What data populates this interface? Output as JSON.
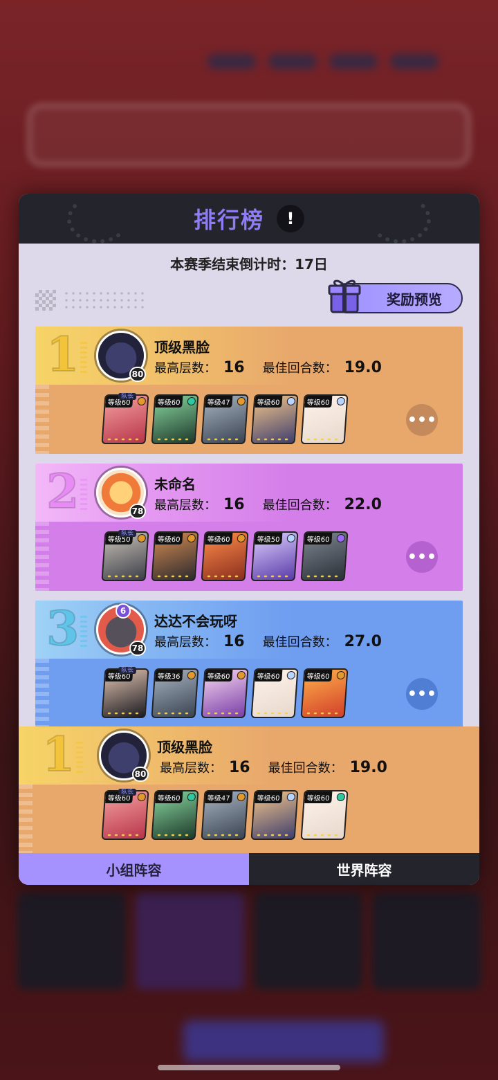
{
  "modal": {
    "title": "排行榜",
    "info_label": "!",
    "countdown": "本赛季结束倒计时：17日",
    "reward_button": "奖励预览"
  },
  "labels": {
    "max_floor": "最高层数：",
    "best_rounds": "最佳回合数："
  },
  "entries": [
    {
      "rank": "1",
      "name": "顶级黑脸",
      "avatar_level": "80",
      "max_floor": "16",
      "best_rounds": "19.0",
      "captain_label": "队长",
      "heroes": [
        "等级60",
        "等级60",
        "等级47",
        "等级60",
        "等级60"
      ],
      "more": "•••"
    },
    {
      "rank": "2",
      "name": "未命名",
      "avatar_level": "78",
      "max_floor": "16",
      "best_rounds": "22.0",
      "captain_label": "队长",
      "heroes": [
        "等级50",
        "等级60",
        "等级60",
        "等级50",
        "等级60"
      ],
      "more": "•••"
    },
    {
      "rank": "3",
      "name": "达达不会玩呀",
      "avatar_level": "78",
      "badge": "6",
      "max_floor": "16",
      "best_rounds": "27.0",
      "captain_label": "队长",
      "heroes": [
        "等级60",
        "等级36",
        "等级60",
        "等级60",
        "等级60"
      ],
      "more": "•••"
    },
    {
      "rank": "1",
      "name": "顶级黑脸",
      "avatar_level": "80",
      "max_floor": "16",
      "best_rounds": "19.0",
      "captain_label": "队长",
      "heroes": [
        "等级60",
        "等级60",
        "等级47",
        "等级60",
        "等级60"
      ]
    }
  ],
  "tabs": [
    "小组阵容",
    "世界阵容"
  ],
  "colors": {
    "rank1": "#e8a86c",
    "rank1_top": "#f3c66a",
    "rank2": "#d47ee9",
    "rank3": "#6f9df0",
    "accent": "#a692ff"
  }
}
